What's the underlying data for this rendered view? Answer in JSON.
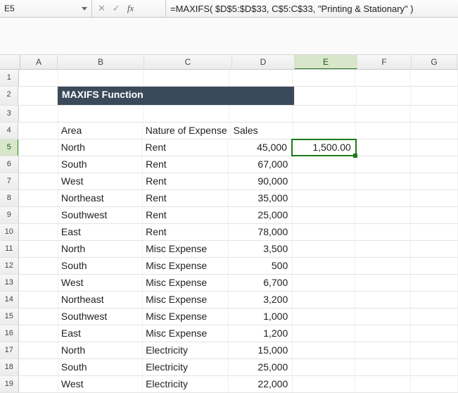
{
  "namebox": {
    "ref": "E5"
  },
  "fx": {
    "x": "✕",
    "check": "✓",
    "fx": "fx"
  },
  "formula": {
    "text": "=MAXIFS( $D$5:$D$33, C$5:C$33, \"Printing & Stationary\" )"
  },
  "columns": [
    "A",
    "B",
    "C",
    "D",
    "E",
    "F",
    "G"
  ],
  "title": "MAXIFS Function",
  "headers": {
    "area": "Area",
    "nature": "Nature of Expense",
    "sales": "Sales"
  },
  "result": "1,500.00",
  "rows": [
    {
      "area": "North",
      "nature": "Rent",
      "sales": "45,000"
    },
    {
      "area": "South",
      "nature": "Rent",
      "sales": "67,000"
    },
    {
      "area": "West",
      "nature": "Rent",
      "sales": "90,000"
    },
    {
      "area": "Northeast",
      "nature": "Rent",
      "sales": "35,000"
    },
    {
      "area": "Southwest",
      "nature": "Rent",
      "sales": "25,000"
    },
    {
      "area": "East",
      "nature": "Rent",
      "sales": "78,000"
    },
    {
      "area": "North",
      "nature": "Misc Expense",
      "sales": "3,500"
    },
    {
      "area": "South",
      "nature": "Misc Expense",
      "sales": "500"
    },
    {
      "area": "West",
      "nature": "Misc Expense",
      "sales": "6,700"
    },
    {
      "area": "Northeast",
      "nature": "Misc Expense",
      "sales": "3,200"
    },
    {
      "area": "Southwest",
      "nature": "Misc Expense",
      "sales": "1,000"
    },
    {
      "area": "East",
      "nature": "Misc Expense",
      "sales": "1,200"
    },
    {
      "area": "North",
      "nature": "Electricity",
      "sales": "15,000"
    },
    {
      "area": "South",
      "nature": "Electricity",
      "sales": "25,000"
    },
    {
      "area": "West",
      "nature": "Electricity",
      "sales": "22,000"
    }
  ],
  "rownums": [
    "1",
    "2",
    "3",
    "4",
    "5",
    "6",
    "7",
    "8",
    "9",
    "10",
    "11",
    "12",
    "13",
    "14",
    "15",
    "16",
    "17",
    "18",
    "19"
  ]
}
